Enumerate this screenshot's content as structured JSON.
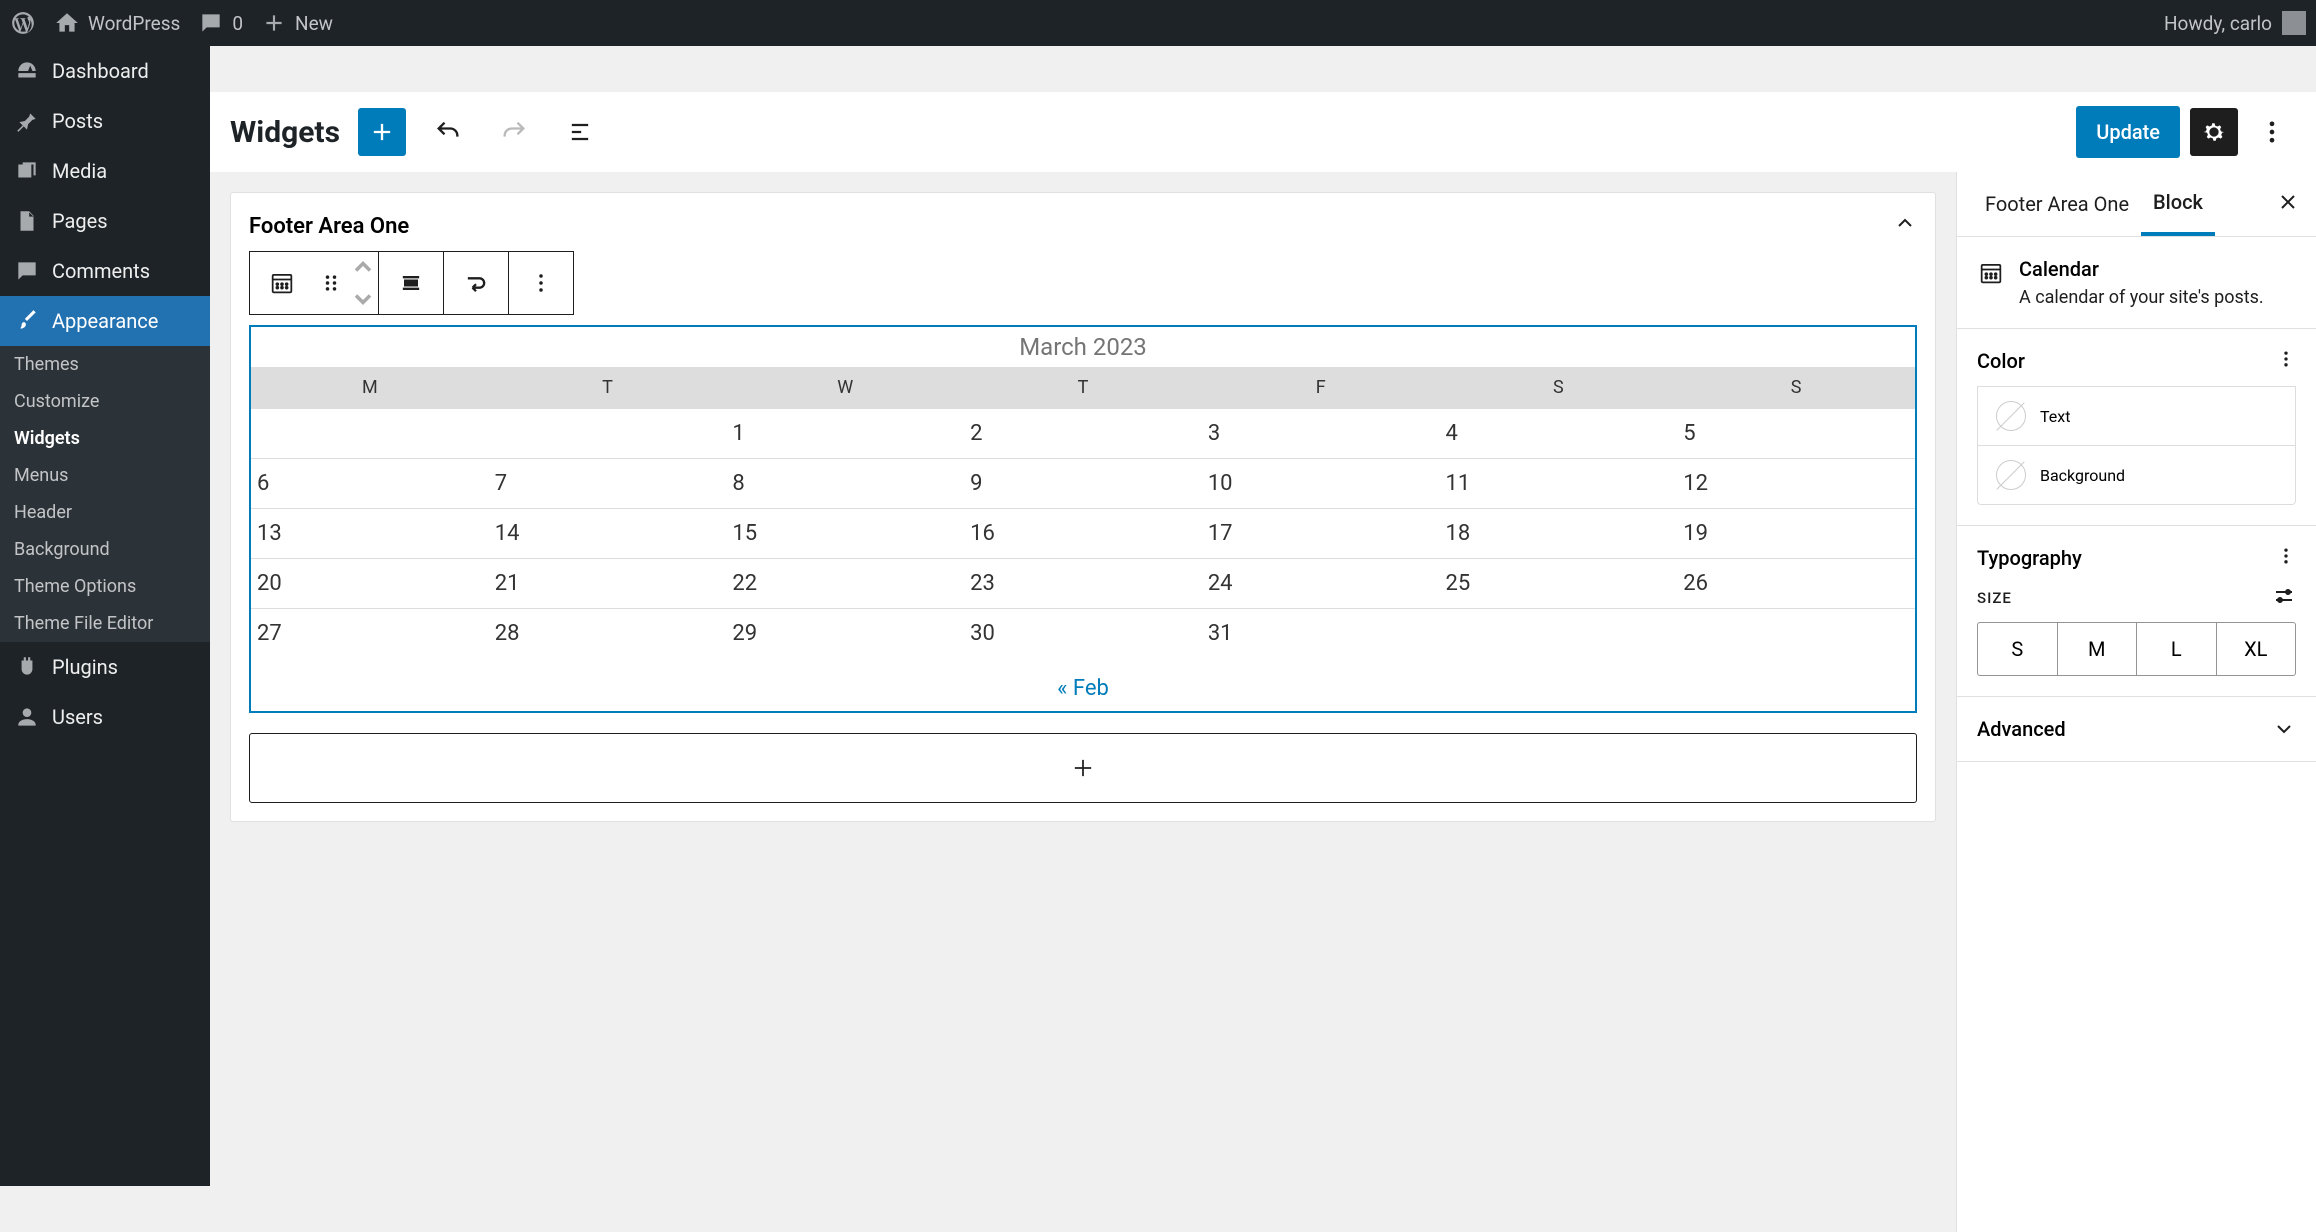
{
  "admin_bar": {
    "site_name": "WordPress",
    "comments_count": "0",
    "new_label": "New",
    "greeting": "Howdy, carlo"
  },
  "sidebar": {
    "items": [
      {
        "label": "Dashboard"
      },
      {
        "label": "Posts"
      },
      {
        "label": "Media"
      },
      {
        "label": "Pages"
      },
      {
        "label": "Comments"
      },
      {
        "label": "Appearance"
      },
      {
        "label": "Plugins"
      },
      {
        "label": "Users"
      }
    ],
    "appearance_sub": [
      {
        "label": "Themes"
      },
      {
        "label": "Customize"
      },
      {
        "label": "Widgets"
      },
      {
        "label": "Menus"
      },
      {
        "label": "Header"
      },
      {
        "label": "Background"
      },
      {
        "label": "Theme Options"
      },
      {
        "label": "Theme File Editor"
      }
    ]
  },
  "editor": {
    "title": "Widgets",
    "update_label": "Update",
    "widget_area_title": "Footer Area One"
  },
  "chart_data": {
    "type": "table",
    "caption": "March 2023",
    "headers": [
      "M",
      "T",
      "W",
      "T",
      "F",
      "S",
      "S"
    ],
    "rows": [
      [
        "",
        "",
        "1",
        "2",
        "3",
        "4",
        "5"
      ],
      [
        "6",
        "7",
        "8",
        "9",
        "10",
        "11",
        "12"
      ],
      [
        "13",
        "14",
        "15",
        "16",
        "17",
        "18",
        "19"
      ],
      [
        "20",
        "21",
        "22",
        "23",
        "24",
        "25",
        "26"
      ],
      [
        "27",
        "28",
        "29",
        "30",
        "31",
        "",
        ""
      ]
    ],
    "prev_link": "« Feb"
  },
  "inspector": {
    "tab1": "Footer Area One",
    "tab2": "Block",
    "block_title": "Calendar",
    "block_desc": "A calendar of your site's posts.",
    "color_heading": "Color",
    "color_text": "Text",
    "color_bg": "Background",
    "typography_heading": "Typography",
    "size_label": "Size",
    "sizes": [
      "S",
      "M",
      "L",
      "XL"
    ],
    "advanced": "Advanced"
  }
}
